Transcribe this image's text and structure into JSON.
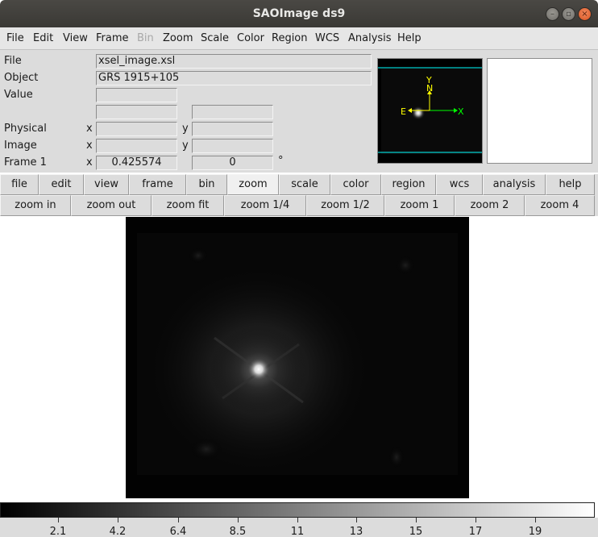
{
  "window": {
    "title": "SAOImage ds9"
  },
  "menubar": {
    "items": [
      "File",
      "Edit",
      "View",
      "Frame",
      "Bin",
      "Zoom",
      "Scale",
      "Color",
      "Region",
      "WCS",
      "Analysis",
      "Help"
    ]
  },
  "info": {
    "file_label": "File",
    "file_value": "xsel_image.xsl",
    "object_label": "Object",
    "object_value": "GRS 1915+105",
    "value_label": "Value",
    "value_value": "",
    "physical_label": "Physical",
    "image_label": "Image",
    "frame_label": "Frame 1",
    "x_label": "x",
    "y_label": "y",
    "frame_x": "0.425574",
    "frame_angle": "0",
    "degree_symbol": "°"
  },
  "panner": {
    "y": "Y",
    "n": "N",
    "e": "E",
    "x": "X"
  },
  "buttonbar": {
    "items": [
      "file",
      "edit",
      "view",
      "frame",
      "bin",
      "zoom",
      "scale",
      "color",
      "region",
      "wcs",
      "analysis",
      "help"
    ],
    "active": "zoom"
  },
  "zoombar": {
    "items": [
      "zoom in",
      "zoom out",
      "zoom fit",
      "zoom 1/4",
      "zoom 1/2",
      "zoom 1",
      "zoom 2",
      "zoom 4"
    ]
  },
  "colorbar": {
    "ticks": [
      "2.1",
      "4.2",
      "6.4",
      "8.5",
      "11",
      "13",
      "15",
      "17",
      "19"
    ]
  },
  "colors": {
    "menu_disabled": "#a8a8a8",
    "compass_yellow": "#ffff00",
    "compass_green": "#00ff00",
    "panner_box": "#00ffff"
  }
}
